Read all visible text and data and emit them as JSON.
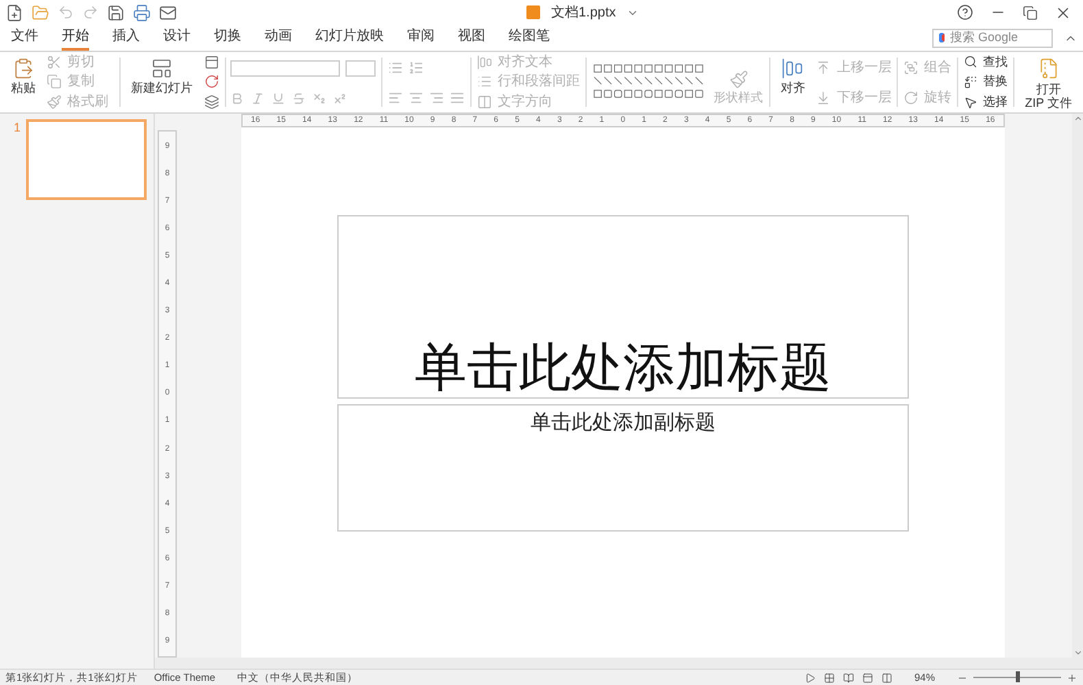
{
  "window": {
    "title": "文档1.pptx",
    "search": {
      "placeholder": "搜索 Google"
    }
  },
  "tabs": [
    {
      "label": "文件",
      "selected": false
    },
    {
      "label": "开始",
      "selected": true
    },
    {
      "label": "插入",
      "selected": false
    },
    {
      "label": "设计",
      "selected": false
    },
    {
      "label": "切换",
      "selected": false
    },
    {
      "label": "动画",
      "selected": false
    },
    {
      "label": "幻灯片放映",
      "selected": false
    },
    {
      "label": "审阅",
      "selected": false
    },
    {
      "label": "视图",
      "selected": false
    },
    {
      "label": "绘图笔",
      "selected": false
    }
  ],
  "ribbon": {
    "paste": "粘贴",
    "clipboard": [
      {
        "label": "剪切",
        "disabled": true
      },
      {
        "label": "复制",
        "disabled": true
      },
      {
        "label": "格式刷",
        "disabled": true
      }
    ],
    "new_slide": "新建幻灯片",
    "paragraph": [
      {
        "label": "对齐文本",
        "disabled": true
      },
      {
        "label": "行和段落间距",
        "disabled": true
      },
      {
        "label": "文字方向",
        "disabled": true
      }
    ],
    "shape_style": {
      "label": "形状样式",
      "disabled": true
    },
    "align": "对齐",
    "arrange": [
      {
        "label": "上移一层",
        "disabled": true
      },
      {
        "label": "下移一层",
        "disabled": true
      }
    ],
    "group": [
      {
        "label": "组合",
        "disabled": true
      },
      {
        "label": "旋转",
        "disabled": true
      }
    ],
    "editing": [
      {
        "label": "查找",
        "kind": "find"
      },
      {
        "label": "替换",
        "kind": "replace"
      },
      {
        "label": "选择",
        "kind": "select"
      }
    ],
    "zip": "打开\nZIP 文件"
  },
  "slides": [
    {
      "number": "1",
      "selected": true
    }
  ],
  "ruler": {
    "horizontal": [
      "16",
      "15",
      "14",
      "13",
      "12",
      "11",
      "10",
      "9",
      "8",
      "7",
      "6",
      "5",
      "4",
      "3",
      "2",
      "1",
      "0",
      "1",
      "2",
      "3",
      "4",
      "5",
      "6",
      "7",
      "8",
      "9",
      "10",
      "11",
      "12",
      "13",
      "14",
      "15",
      "16"
    ],
    "vertical": [
      "9",
      "8",
      "7",
      "6",
      "5",
      "4",
      "3",
      "2",
      "1",
      "0",
      "1",
      "2",
      "3",
      "4",
      "5",
      "6",
      "7",
      "8",
      "9"
    ]
  },
  "slide": {
    "title": "单击此处添加标题",
    "subtitle": "单击此处添加副标题"
  },
  "status_bar": {
    "slide_info": "第1张幻灯片，共1张幻灯片",
    "theme": "Office Theme",
    "language": "中文（中华人民共和国）",
    "zoom": "94%",
    "zoom_slider": {
      "level": 0.5
    }
  }
}
